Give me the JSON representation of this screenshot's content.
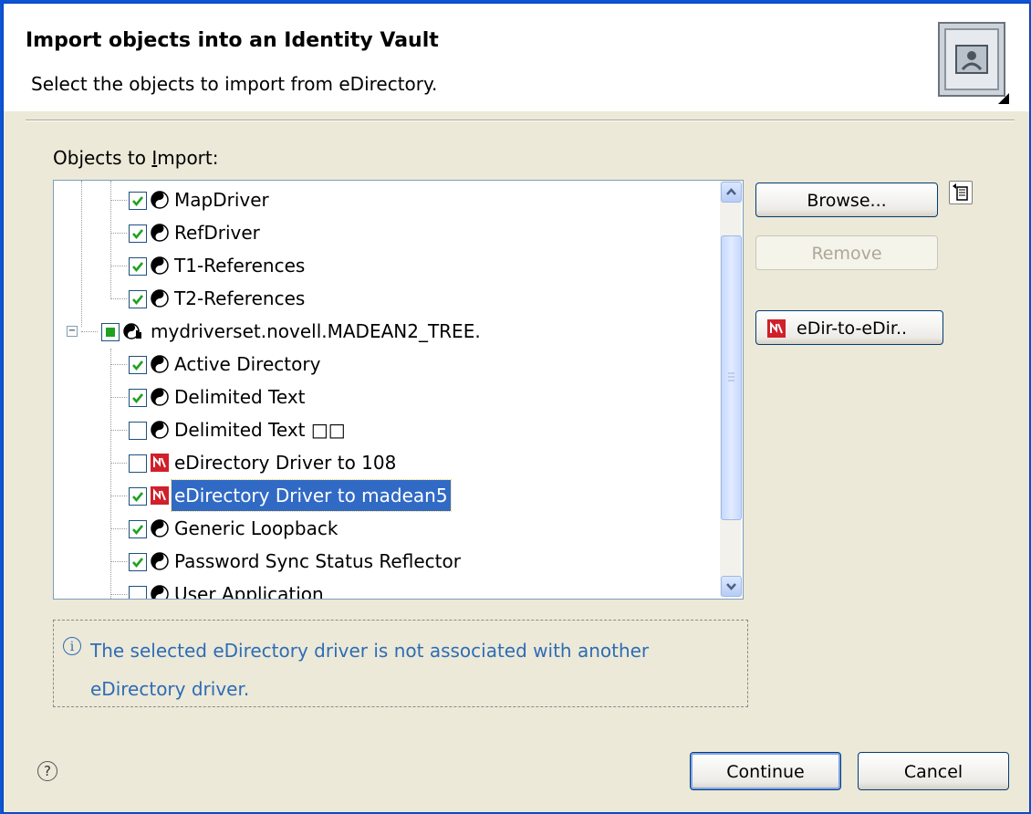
{
  "header": {
    "title": "Import objects into an Identity Vault",
    "subtitle": "Select the objects to import from eDirectory."
  },
  "objects_label": {
    "pre": "Objects to ",
    "accel": "I",
    "post": "mport:"
  },
  "tree": {
    "rows": [
      {
        "label": "MapDriver",
        "checked": true,
        "icon": "yin-yang-driver-icon"
      },
      {
        "label": "RefDriver",
        "checked": true,
        "icon": "yin-yang-driver-icon"
      },
      {
        "label": "T1-References",
        "checked": true,
        "icon": "yin-yang-driver-icon"
      },
      {
        "label": "T2-References",
        "checked": true,
        "icon": "yin-yang-driver-icon"
      },
      {
        "label": "mydriverset.novell.MADEAN2_TREE.",
        "checked": "partial",
        "icon": "driver-set-icon",
        "expanded": true
      },
      {
        "label": "Active Directory",
        "checked": true,
        "icon": "yin-yang-driver-icon"
      },
      {
        "label": "Delimited Text",
        "checked": true,
        "icon": "yin-yang-driver-icon"
      },
      {
        "label": "Delimited Text □□",
        "checked": false,
        "icon": "yin-yang-driver-icon"
      },
      {
        "label": "eDirectory Driver to 108",
        "checked": false,
        "icon": "edirectory-driver-icon"
      },
      {
        "label": "eDirectory Driver to madean5",
        "checked": true,
        "icon": "edirectory-driver-icon",
        "selected": true
      },
      {
        "label": "Generic Loopback",
        "checked": true,
        "icon": "yin-yang-driver-icon"
      },
      {
        "label": "Password Sync Status Reflector",
        "checked": true,
        "icon": "yin-yang-driver-icon"
      },
      {
        "label": "User Application",
        "checked": false,
        "icon": "yin-yang-driver-icon"
      }
    ]
  },
  "buttons": {
    "browse": "Browse...",
    "remove": "Remove",
    "edir": "eDir-to-eDir..",
    "continue": "Continue",
    "cancel": "Cancel"
  },
  "info": {
    "text": "The selected eDirectory driver is not associated with another eDirectory driver."
  },
  "colors": {
    "accent": "#316ac5",
    "info_text": "#2e6cb5",
    "check": "#21a121"
  }
}
